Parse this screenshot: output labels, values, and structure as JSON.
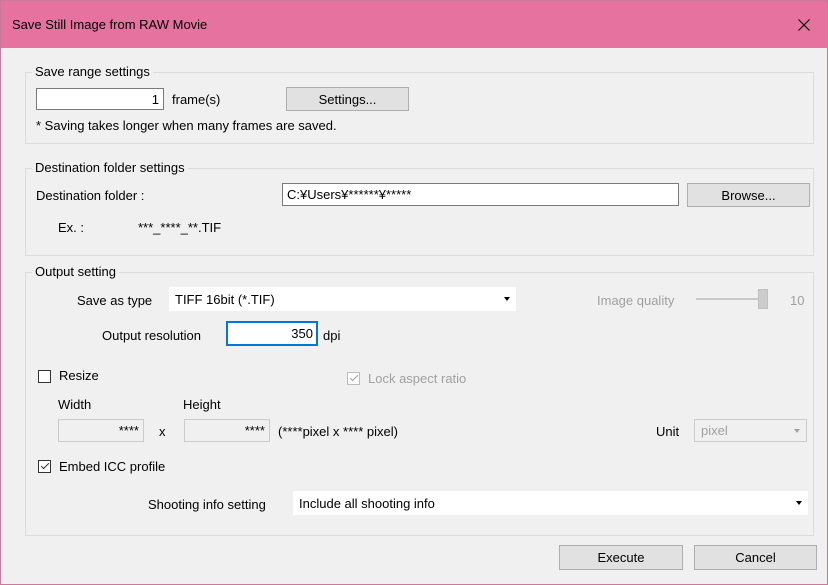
{
  "window": {
    "title": "Save Still Image from RAW Movie"
  },
  "save_range": {
    "legend": "Save range settings",
    "frames_value": "1",
    "frames_unit": "frame(s)",
    "settings_button": "Settings...",
    "note": "* Saving takes longer when many frames are saved."
  },
  "destination": {
    "legend": "Destination folder settings",
    "label": "Destination folder :",
    "path_value": "C:¥Users¥******¥*****",
    "browse_button": "Browse...",
    "example_label": "Ex. :",
    "example_value": "***_****_**.TIF"
  },
  "output": {
    "legend": "Output setting",
    "save_as_type_label": "Save as type",
    "save_as_type_value": "TIFF 16bit (*.TIF)",
    "image_quality_label": "Image quality",
    "image_quality_value": "10",
    "resolution_label": "Output resolution",
    "resolution_value": "350",
    "resolution_unit": "dpi",
    "resize_label": "Resize",
    "resize_checked": false,
    "lock_aspect_label": "Lock aspect ratio",
    "lock_aspect_checked": true,
    "width_label": "Width",
    "height_label": "Height",
    "width_value": "****",
    "height_value": "****",
    "times_sign": "x",
    "pixel_info": "(****pixel x **** pixel)",
    "unit_label": "Unit",
    "unit_value": "pixel",
    "embed_icc_label": "Embed ICC profile",
    "embed_icc_checked": true,
    "shooting_info_label": "Shooting info setting",
    "shooting_info_value": "Include all shooting info"
  },
  "footer": {
    "execute_button": "Execute",
    "cancel_button": "Cancel"
  },
  "colors": {
    "titlebar": "#e672a0",
    "focus_border": "#0078d7"
  }
}
